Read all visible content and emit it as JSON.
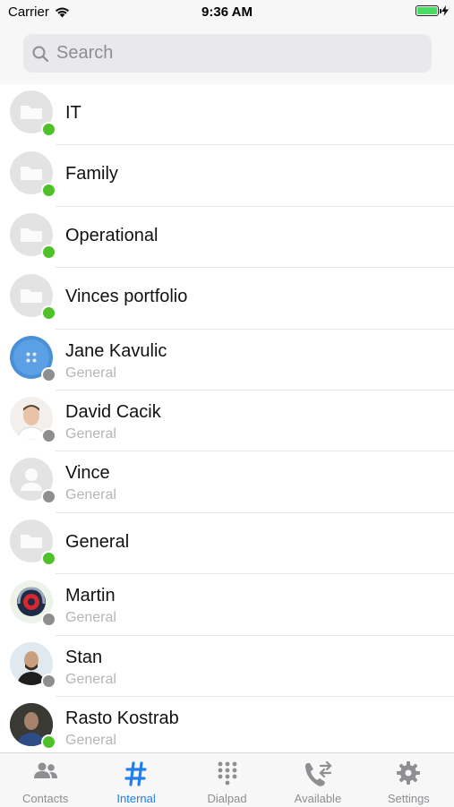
{
  "status_bar": {
    "carrier": "Carrier",
    "time": "9:36 AM"
  },
  "search": {
    "placeholder": "Search",
    "value": ""
  },
  "contacts": [
    {
      "name": "IT",
      "subtitle": "",
      "avatar": "folder-icon",
      "status": "online"
    },
    {
      "name": "Family",
      "subtitle": "",
      "avatar": "folder-icon",
      "status": "online"
    },
    {
      "name": "Operational",
      "subtitle": "",
      "avatar": "folder-icon",
      "status": "online"
    },
    {
      "name": "Vinces portfolio",
      "subtitle": "",
      "avatar": "folder-icon",
      "status": "online"
    },
    {
      "name": "Jane Kavulic",
      "subtitle": "General",
      "avatar": "button-photo",
      "status": "offline"
    },
    {
      "name": "David Cacik",
      "subtitle": "General",
      "avatar": "person-photo",
      "status": "offline"
    },
    {
      "name": "Vince",
      "subtitle": "General",
      "avatar": "person-placeholder-icon",
      "status": "offline"
    },
    {
      "name": "General",
      "subtitle": "",
      "avatar": "folder-icon",
      "status": "online"
    },
    {
      "name": "Martin",
      "subtitle": "General",
      "avatar": "headphones-photo",
      "status": "offline"
    },
    {
      "name": "Stan",
      "subtitle": "General",
      "avatar": "person-photo",
      "status": "offline"
    },
    {
      "name": "Rasto Kostrab",
      "subtitle": "General",
      "avatar": "person-photo",
      "status": "online"
    }
  ],
  "tabs": [
    {
      "label": "Contacts",
      "icon": "contacts-icon",
      "active": false
    },
    {
      "label": "Internal",
      "icon": "hash-icon",
      "active": true
    },
    {
      "label": "Dialpad",
      "icon": "dialpad-icon",
      "active": false
    },
    {
      "label": "Available",
      "icon": "phone-transfer-icon",
      "active": false
    },
    {
      "label": "Settings",
      "icon": "gear-icon",
      "active": false
    }
  ],
  "colors": {
    "accent": "#1f7ff1",
    "online": "#4fc128",
    "offline": "#8e8e8e",
    "subtitle": "#b5b5b5"
  }
}
